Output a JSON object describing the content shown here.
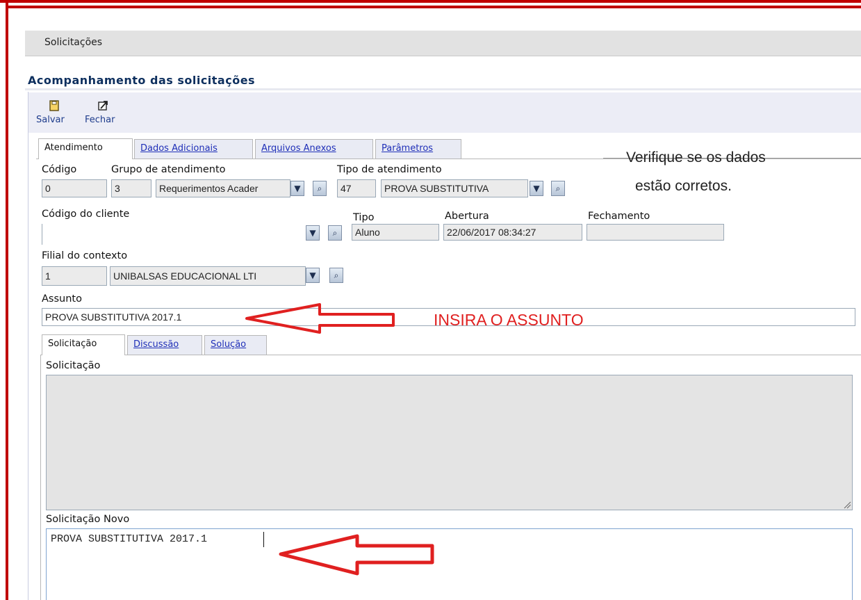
{
  "header": {
    "title": "Solicitações"
  },
  "section": {
    "title": "Acompanhamento das solicitações"
  },
  "toolbar": {
    "save_label": "Salvar",
    "close_label": "Fechar",
    "save_icon": "save-icon",
    "close_icon": "close-icon"
  },
  "tabs": [
    {
      "label": "Atendimento",
      "active": true
    },
    {
      "label": "Dados Adicionais",
      "active": false
    },
    {
      "label": "Arquivos Anexos",
      "active": false
    },
    {
      "label": "Parâmetros",
      "active": false
    }
  ],
  "fields": {
    "codigo": {
      "label": "Código",
      "value": "0"
    },
    "grupo": {
      "label": "Grupo de atendimento",
      "code": "3",
      "value": "Requerimentos Acader"
    },
    "tipo_atendimento": {
      "label": "Tipo de atendimento",
      "code": "47",
      "value": "PROVA SUBSTITUTIVA"
    },
    "codigo_cliente": {
      "label": "Código do cliente",
      "value": ""
    },
    "tipo": {
      "label": "Tipo",
      "value": "Aluno"
    },
    "abertura": {
      "label": "Abertura",
      "value": "22/06/2017 08:34:27"
    },
    "fechamento": {
      "label": "Fechamento",
      "value": ""
    },
    "filial": {
      "label": "Filial do contexto",
      "code": "1",
      "value": "UNIBALSAS EDUCACIONAL LTI"
    },
    "assunto": {
      "label": "Assunto",
      "value": "PROVA SUBSTITUTIVA 2017.1"
    }
  },
  "subtabs": [
    {
      "label": "Solicitação",
      "active": true
    },
    {
      "label": "Discussão",
      "active": false
    },
    {
      "label": "Solução",
      "active": false
    }
  ],
  "solicitacao": {
    "label": "Solicitação",
    "value": ""
  },
  "solicitacao_novo": {
    "label": "Solicitação Novo",
    "value": "PROVA SUBSTITUTIVA 2017.1"
  },
  "annotations": {
    "verify_line1": "Verifique se os dados",
    "verify_line2": "estão corretos.",
    "insira": "INSIRA O ASSUNTO",
    "accent_red": "#e02020"
  }
}
